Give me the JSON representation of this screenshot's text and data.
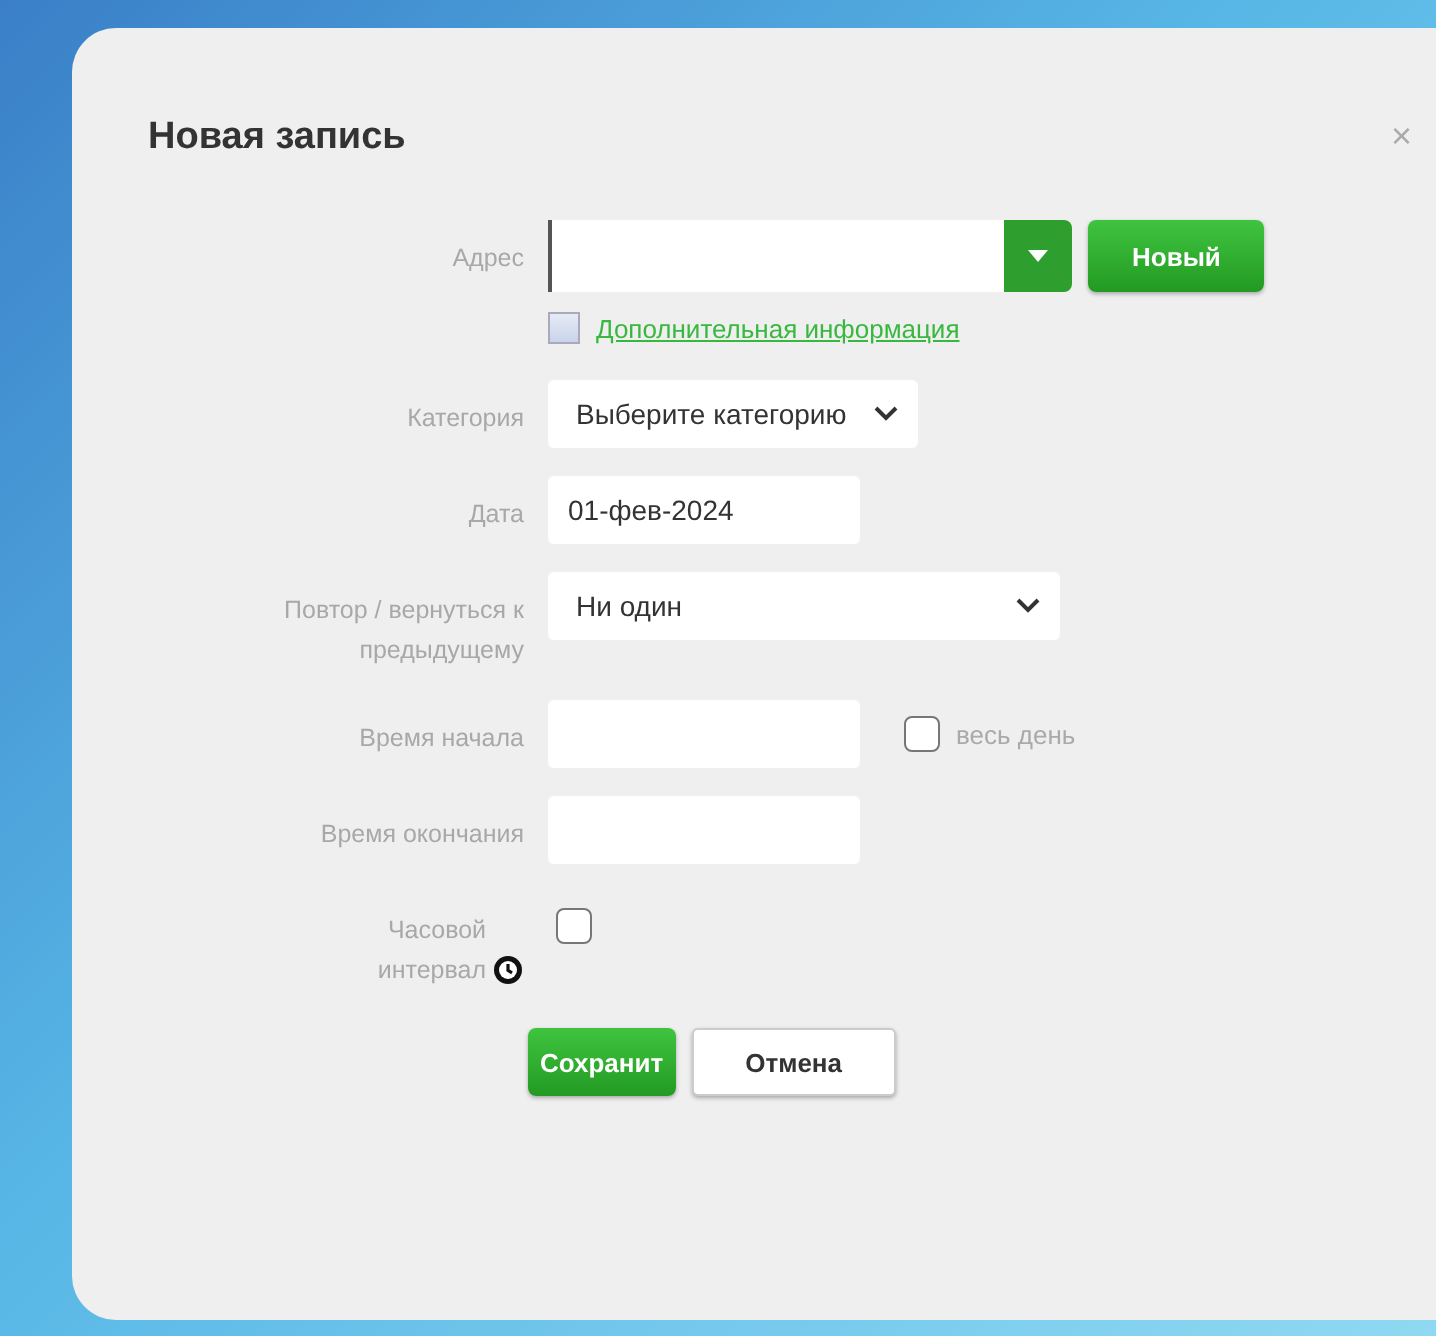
{
  "dialog": {
    "title": "Новая запись",
    "close": "×"
  },
  "fields": [
    {
      "kind": "address",
      "label": "Адрес",
      "button": "Новый"
    },
    {
      "kind": "link",
      "checked": false,
      "text": "Дополнительная информация"
    },
    {
      "kind": "select",
      "label": "Категория",
      "value": "Выберите категорию"
    },
    {
      "kind": "text",
      "label": "Дата",
      "value": "01-фев-2024"
    },
    {
      "kind": "select",
      "label": "Повтор / вернуться к предыдущему",
      "value": "Ни один"
    },
    {
      "kind": "time",
      "label": "Время начала",
      "checkbox": {
        "label": "весь день",
        "checked": false
      }
    },
    {
      "kind": "time",
      "label": "Время окончания"
    },
    {
      "kind": "check",
      "label": "Часовой интервал",
      "checked": false
    }
  ],
  "buttons": [
    {
      "label": "Сохранит",
      "primary": true
    },
    {
      "label": "Отмена",
      "primary": false
    }
  ]
}
